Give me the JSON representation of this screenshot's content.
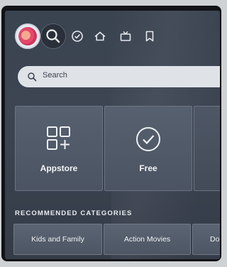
{
  "nav": {
    "items": [
      {
        "icon": "profile-avatar"
      },
      {
        "icon": "search-icon"
      },
      {
        "icon": "check-circle-icon"
      },
      {
        "icon": "home-icon"
      },
      {
        "icon": "live-tv-icon"
      },
      {
        "icon": "bookmark-icon"
      }
    ]
  },
  "search": {
    "placeholder": "Search"
  },
  "tiles": [
    {
      "label": "Appstore",
      "icon": "appstore-grid-icon"
    },
    {
      "label": "Free",
      "icon": "check-circle-icon"
    },
    {
      "label": "",
      "icon": ""
    }
  ],
  "recommended": {
    "title": "RECOMMENDED CATEGORIES",
    "categories": [
      "Kids and Family",
      "Action Movies",
      "Do"
    ]
  },
  "colors": {
    "screen_bg": "#3a4350",
    "tile_bg": "#56606e",
    "search_bg": "#dfe3e8"
  }
}
